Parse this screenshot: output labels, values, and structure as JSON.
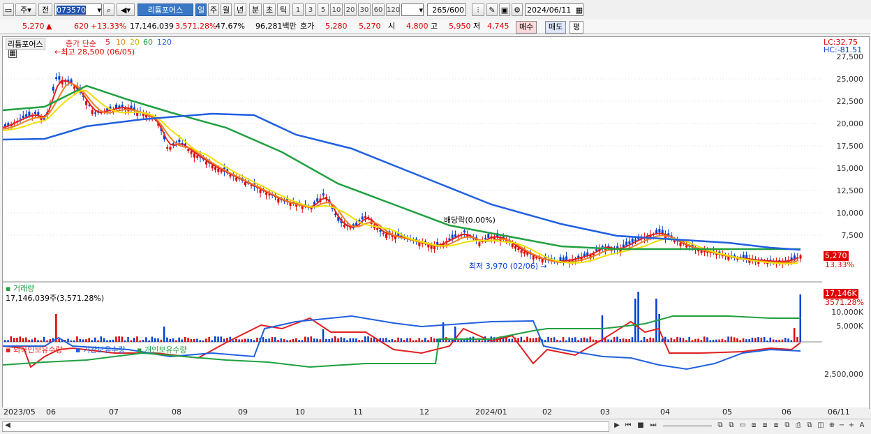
{
  "toolbar": {
    "period": "주",
    "mode": "전",
    "code": "073570",
    "name": "리튬포어스",
    "intervals": [
      "일",
      "주",
      "월",
      "년",
      "분",
      "초",
      "틱"
    ],
    "active_interval": "일",
    "minutes": [
      "1",
      "3",
      "5",
      "10",
      "20",
      "30",
      "60",
      "120"
    ],
    "count": "265",
    "total": "/600",
    "date": "2024/06/11"
  },
  "quote": {
    "price": "5,270",
    "arrow": "▲",
    "change": "620",
    "change_pct": "+13.33%",
    "volume": "17,146,039",
    "volume_pct": "3,571.28%",
    "turnover": "47.67%",
    "amount": "96,281백만",
    "hoga_label": "호가",
    "ask": "5,280",
    "bid": "5,270",
    "open_label": "시",
    "open": "4,800",
    "high_label": "고",
    "high": "5,950",
    "low_label": "저",
    "low": "4,745",
    "buy": "매수",
    "sell": "매도",
    "eval": "평"
  },
  "price_panel": {
    "stock": "리튬포어스",
    "legend_prefix": "종가 단순",
    "ma_labels": [
      "5",
      "10",
      "20",
      "60",
      "120"
    ],
    "high_note": "최고 28,500 (06/05)",
    "low_note": "최저 3,970 (02/06)",
    "dividend_note": "배당락(0.00%)",
    "lc": "LC:32.75",
    "hc": "HC:-81.51",
    "current_tag": "5,270",
    "current_pct": "13.33%",
    "y_ticks": [
      "27,500",
      "25,000",
      "22,500",
      "20,000",
      "17,500",
      "15,000",
      "12,500",
      "10,000",
      "7,500"
    ]
  },
  "volume_panel": {
    "title": "거래량",
    "value": "17,146,039주(3,571.28%)",
    "tag": "17,146K",
    "tag_pct": "3571.28%",
    "y_ticks": [
      "10,000K",
      "5,000K"
    ]
  },
  "holding_panel": {
    "series": [
      "외국인보유수량",
      "기관보유수량",
      "개인보유수량"
    ],
    "y_tick": "2,500,000"
  },
  "x_labels": [
    "2023/05",
    "06",
    "07",
    "08",
    "09",
    "10",
    "11",
    "12",
    "2024/01",
    "02",
    "03",
    "04",
    "05",
    "06"
  ],
  "x_right": "06/11",
  "colors": {
    "ma5": "#e02020",
    "ma10": "#f08020",
    "ma20": "#f0e000",
    "ma60": "#20a040",
    "ma120": "#2060e0",
    "up": "#e00000",
    "down": "#0040d0"
  }
}
